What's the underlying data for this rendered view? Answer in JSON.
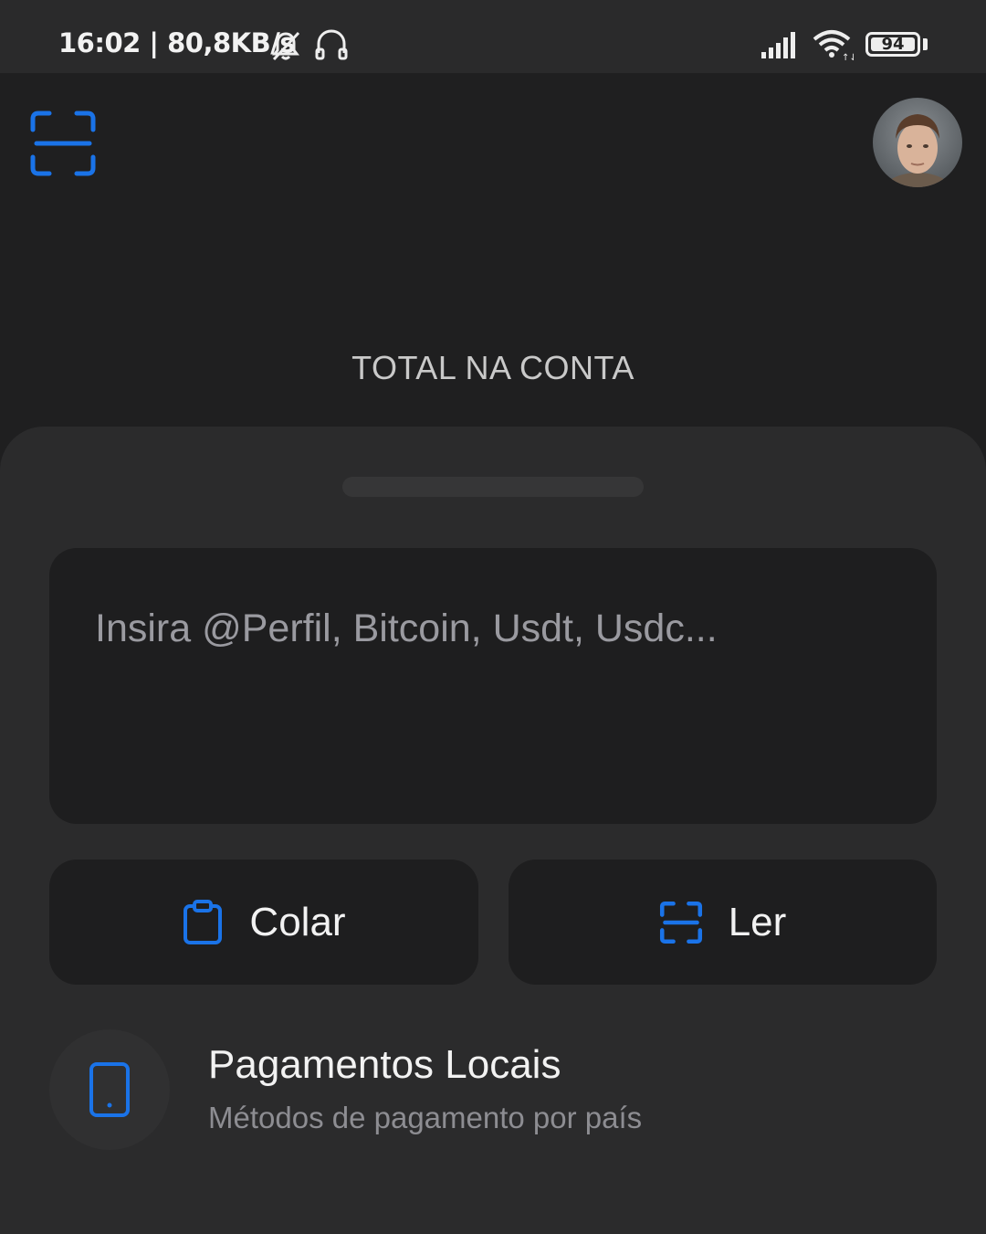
{
  "status_bar": {
    "time_speed": "16:02 | 80,8KB/s",
    "battery": "94",
    "icons": [
      "notifications-muted-icon",
      "headset-icon",
      "signal-icon",
      "wifi-icon",
      "battery-icon"
    ]
  },
  "header": {
    "scan_icon": "scan-icon",
    "avatar": "profile-avatar"
  },
  "account": {
    "total_label": "TOTAL NA CONTA"
  },
  "sheet": {
    "input_placeholder": "Insira @Perfil, Bitcoin, Usdt, Usdc...",
    "paste_label": "Colar",
    "read_label": "Ler",
    "local_payments": {
      "title": "Pagamentos Locais",
      "subtitle": "Métodos de pagamento por país"
    }
  },
  "colors": {
    "accent": "#1a73e8",
    "background": "#1f1f20",
    "sheet": "#2b2b2c",
    "surface": "#1e1e1f"
  }
}
